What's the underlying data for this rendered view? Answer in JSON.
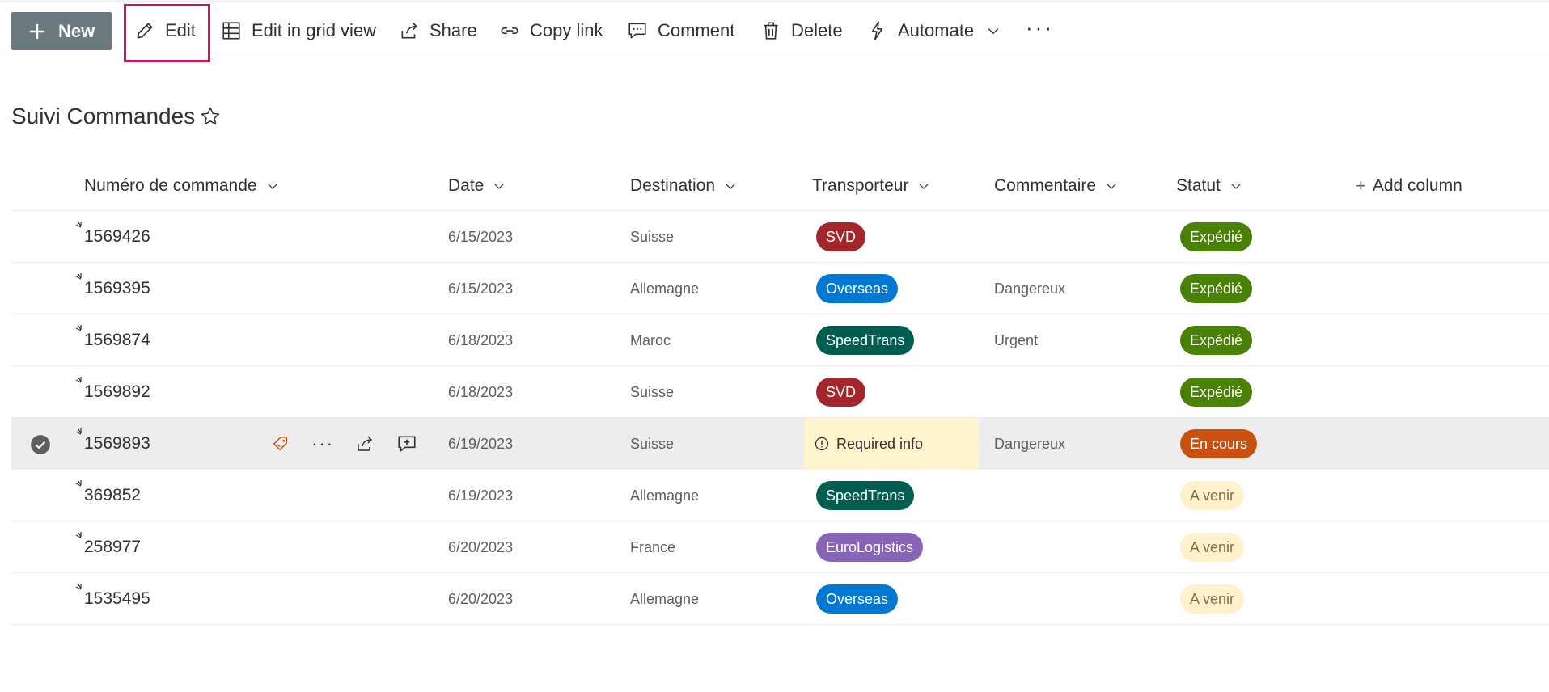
{
  "toolbar": {
    "new_label": "New",
    "edit_label": "Edit",
    "grid_label": "Edit in grid view",
    "share_label": "Share",
    "copy_link_label": "Copy link",
    "comment_label": "Comment",
    "delete_label": "Delete",
    "automate_label": "Automate",
    "more_label": "···"
  },
  "list": {
    "title": "Suivi Commandes"
  },
  "columns": {
    "numero": "Numéro de commande",
    "date": "Date",
    "destination": "Destination",
    "transporteur": "Transporteur",
    "commentaire": "Commentaire",
    "statut": "Statut",
    "add_column": "Add column"
  },
  "rows": [
    {
      "numero": "1569426",
      "date": "6/15/2023",
      "destination": "Suisse",
      "transporteur": "SVD",
      "commentaire": "",
      "statut": "Expédié"
    },
    {
      "numero": "1569395",
      "date": "6/15/2023",
      "destination": "Allemagne",
      "transporteur": "Overseas",
      "commentaire": "Dangereux",
      "statut": "Expédié"
    },
    {
      "numero": "1569874",
      "date": "6/18/2023",
      "destination": "Maroc",
      "transporteur": "SpeedTrans",
      "commentaire": "Urgent",
      "statut": "Expédié"
    },
    {
      "numero": "1569892",
      "date": "6/18/2023",
      "destination": "Suisse",
      "transporteur": "SVD",
      "commentaire": "",
      "statut": "Expédié"
    },
    {
      "numero": "1569893",
      "date": "6/19/2023",
      "destination": "Suisse",
      "transporteur": "Required info",
      "commentaire": "Dangereux",
      "statut": "En cours"
    },
    {
      "numero": "369852",
      "date": "6/19/2023",
      "destination": "Allemagne",
      "transporteur": "SpeedTrans",
      "commentaire": "",
      "statut": "A venir"
    },
    {
      "numero": "258977",
      "date": "6/20/2023",
      "destination": "France",
      "transporteur": "EuroLogistics",
      "commentaire": "",
      "statut": "A venir"
    },
    {
      "numero": "1535495",
      "date": "6/20/2023",
      "destination": "Allemagne",
      "transporteur": "Overseas",
      "commentaire": "",
      "statut": "A venir"
    }
  ],
  "colors": {
    "new_button": "#69797e",
    "edit_highlight": "#c2185b",
    "svd": "#a4262c",
    "overseas": "#0078d4",
    "speedtrans": "#005e50",
    "eurologistics": "#8764b8",
    "expedie": "#498205",
    "en_cours": "#ca5010",
    "a_venir_bg": "#fff1cc",
    "a_venir_text": "#8a6d3b",
    "required_info_bg": "#fff4ce"
  }
}
